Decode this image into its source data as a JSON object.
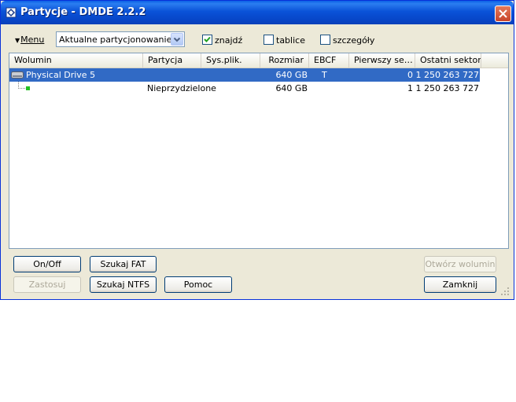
{
  "window": {
    "title": "Partycje - DMDE 2.2.2",
    "close_label": "×"
  },
  "toolbar": {
    "menu_label": "Menu",
    "view_select": {
      "value": "Aktualne partycjonowanie"
    },
    "checkboxes": [
      {
        "label": "znajdź",
        "checked": true
      },
      {
        "label": "tablice",
        "checked": false
      },
      {
        "label": "szczegóły",
        "checked": false
      }
    ]
  },
  "table": {
    "columns": [
      "Wolumin",
      "Partycja",
      "Sys.plik.",
      "Rozmiar",
      "EBCF",
      "Pierwszy se…",
      "Ostatni sektor"
    ],
    "rows": [
      {
        "volume": "Physical Drive 5",
        "partition": "",
        "fs": "",
        "size": "640 GB",
        "ebcf": "T",
        "first": "0",
        "last": "1 250 263 727",
        "selected": true
      },
      {
        "volume": "",
        "partition": "Nieprzydzielone",
        "fs": "",
        "size": "640 GB",
        "ebcf": "",
        "first": "1",
        "last": "1 250 263 727",
        "selected": false
      }
    ]
  },
  "buttons": {
    "onoff": "On/Off",
    "search_fat": "Szukaj FAT",
    "open_volume": "Otwórz wolumin",
    "apply": "Zastosuj",
    "search_ntfs": "Szukaj NTFS",
    "help": "Pomoc",
    "close": "Zamknij"
  },
  "colors": {
    "title_bar": "#0a52d8",
    "selection": "#316ac5",
    "dialog_bg": "#ece9d8"
  }
}
